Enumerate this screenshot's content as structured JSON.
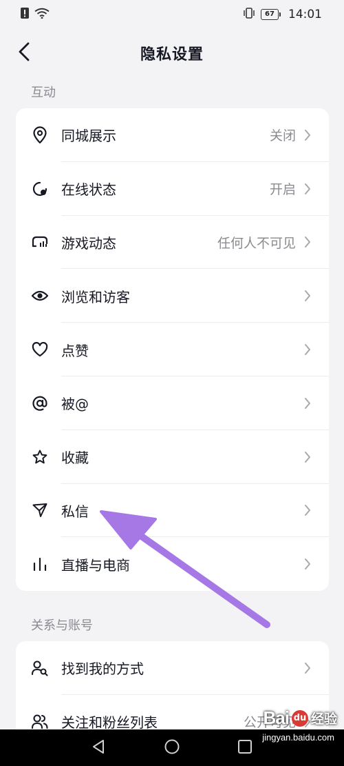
{
  "status_bar": {
    "time": "14:01",
    "battery": "67",
    "alert_icon": "alert-icon",
    "wifi_icon": "wifi-icon",
    "vibrate_icon": "vibrate-icon"
  },
  "header": {
    "title": "隐私设置",
    "back_icon": "chevron-left-icon"
  },
  "sections": [
    {
      "title": "互动",
      "items": [
        {
          "label": "同城展示",
          "value": "关闭",
          "icon": "location-pin-icon"
        },
        {
          "label": "在线状态",
          "value": "开启",
          "icon": "online-status-icon"
        },
        {
          "label": "游戏动态",
          "value": "任何人不可见",
          "icon": "gamepad-icon"
        },
        {
          "label": "浏览和访客",
          "value": "",
          "icon": "eye-icon"
        },
        {
          "label": "点赞",
          "value": "",
          "icon": "heart-icon"
        },
        {
          "label": "被@",
          "value": "",
          "icon": "at-icon"
        },
        {
          "label": "收藏",
          "value": "",
          "icon": "star-icon"
        },
        {
          "label": "私信",
          "value": "",
          "icon": "send-icon"
        },
        {
          "label": "直播与电商",
          "value": "",
          "icon": "live-bars-icon"
        }
      ]
    },
    {
      "title": "关系与账号",
      "items": [
        {
          "label": "找到我的方式",
          "value": "",
          "icon": "find-user-icon"
        },
        {
          "label": "关注和粉丝列表",
          "value": "公开可见",
          "icon": "users-icon"
        }
      ]
    }
  ],
  "annotation": {
    "color": "#a678e6"
  },
  "watermark": {
    "logo": "Bai",
    "paw": "du",
    "cn": "经验",
    "url": "jingyan.baidu.com"
  },
  "colors": {
    "background": "#f3f3f5",
    "card": "#ffffff",
    "text_primary": "#161823",
    "text_secondary": "#8a8b91"
  }
}
